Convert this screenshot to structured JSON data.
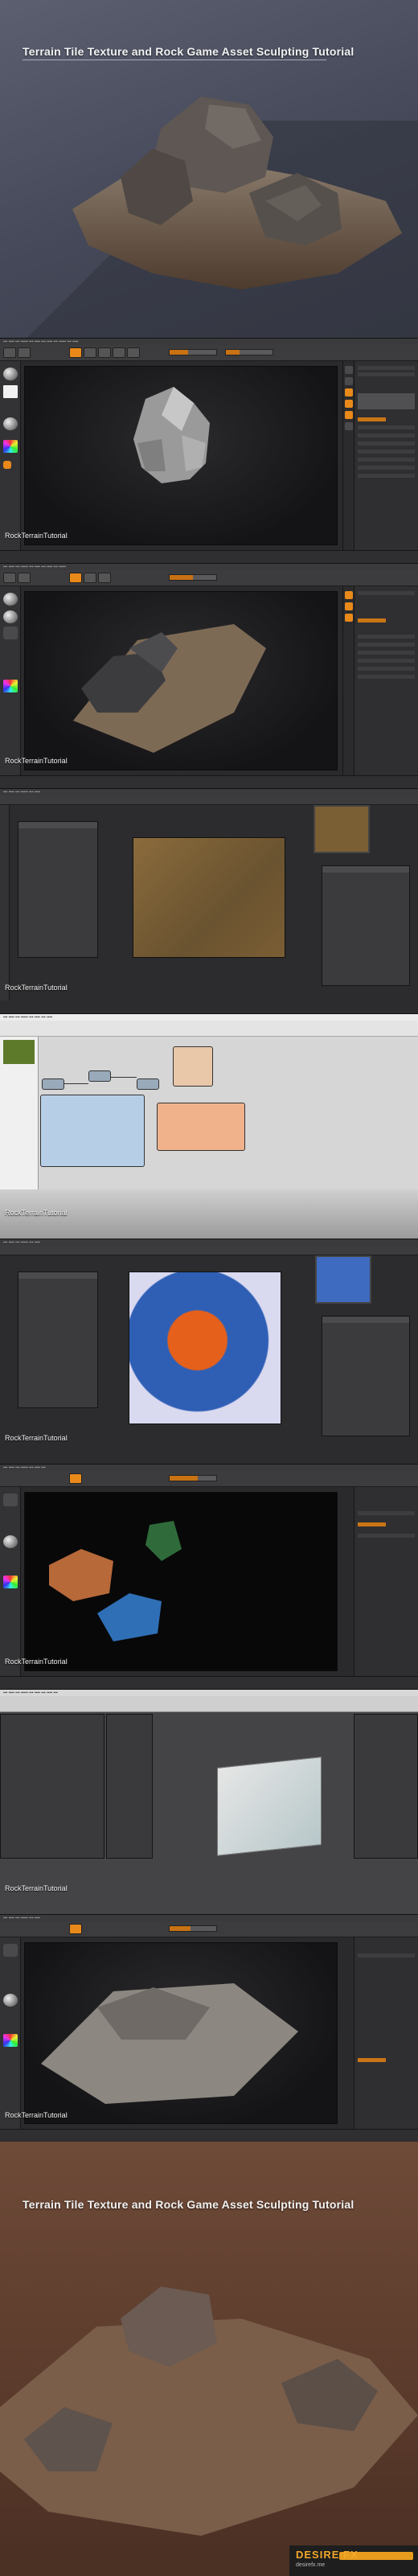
{
  "hero_top": {
    "title": "Terrain Tile Texture and Rock Game Asset Sculpting Tutorial"
  },
  "screens": [
    {
      "id": "zbrush-rock-grey",
      "caption": "RockTerrainTutorial"
    },
    {
      "id": "zbrush-rock-on-terrain",
      "caption": "RockTerrainTutorial"
    },
    {
      "id": "photoshop-terrain-texture",
      "caption": "RockTerrainTutorial"
    },
    {
      "id": "node-editor",
      "caption": "RockTerrainTutorial"
    },
    {
      "id": "photoshop-mask",
      "caption": "RockTerrainTutorial"
    },
    {
      "id": "zbrush-polypaint-rocks",
      "caption": "RockTerrainTutorial"
    },
    {
      "id": "max-terrain-mesh",
      "caption": "RockTerrainTutorial"
    },
    {
      "id": "zbrush-terrain-tile",
      "caption": "RockTerrainTutorial"
    }
  ],
  "hero_bottom": {
    "title": "Terrain Tile Texture and Rock Game Asset Sculpting Tutorial",
    "badge": "DESIRE FX",
    "badge_sub": "desirefx.me"
  },
  "colors": {
    "accent": "#e8891a",
    "hero_top_bg": "#4a4e5e",
    "hero_bottom_bg": "#5a3a2b",
    "app_bg": "#2a2a2c"
  }
}
